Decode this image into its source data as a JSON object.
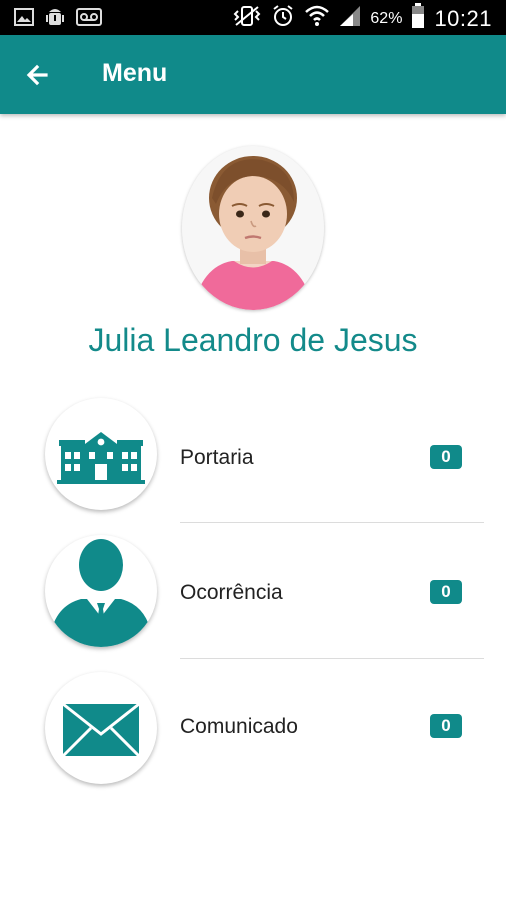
{
  "status_bar": {
    "battery": "62%",
    "time": "10:21",
    "icons": [
      "image-icon",
      "android-debug-icon",
      "voicemail-icon",
      "vibrate-icon",
      "alarm-icon",
      "wifi-icon",
      "signal-icon",
      "battery-icon"
    ]
  },
  "app_bar": {
    "title": "Menu",
    "back_icon": "arrow-left-icon",
    "color": "#108a8a"
  },
  "profile": {
    "name": "Julia Leandro de Jesus",
    "name_color": "#138a8a"
  },
  "menu": {
    "items": [
      {
        "label": "Portaria",
        "count": "0",
        "icon": "school-building-icon"
      },
      {
        "label": "Ocorrência",
        "count": "0",
        "icon": "person-suit-icon"
      },
      {
        "label": "Comunicado",
        "count": "0",
        "icon": "envelope-icon"
      }
    ]
  }
}
